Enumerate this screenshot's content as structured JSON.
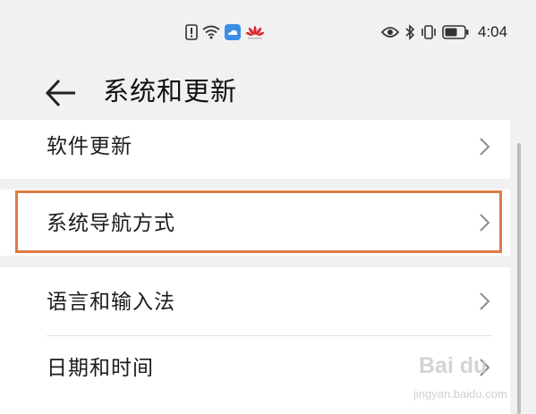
{
  "status_bar": {
    "time": "4:04",
    "left_icons": [
      "alert-icon",
      "wifi-icon",
      "cloud-icon",
      "huawei-logo-icon"
    ],
    "right_icons": [
      "eye-icon",
      "bluetooth-icon",
      "vibrate-icon",
      "battery-icon"
    ]
  },
  "header": {
    "title": "系统和更新",
    "back_icon": "arrow-left-icon"
  },
  "settings": {
    "items": [
      {
        "label": "软件更新"
      },
      {
        "label": "系统导航方式"
      },
      {
        "label": "语言和输入法"
      },
      {
        "label": "日期和时间"
      }
    ]
  },
  "watermark": {
    "brand": "Bai du",
    "url": "jingyan.baidu.com"
  },
  "colors": {
    "background": "#f1f1f1",
    "card": "#ffffff",
    "highlight_border": "#de7b45",
    "chevron": "#8c8c8c"
  }
}
